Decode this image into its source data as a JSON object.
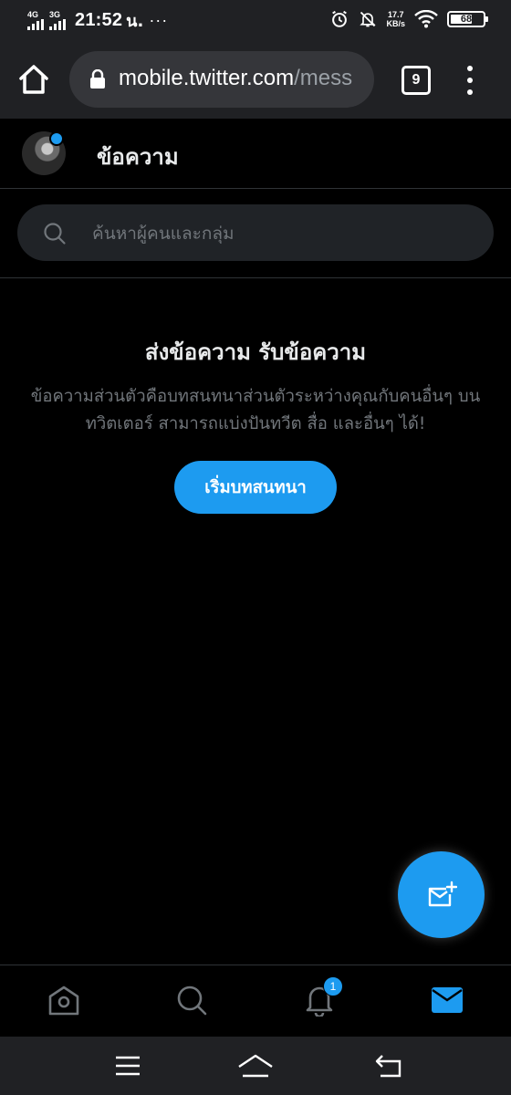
{
  "status_bar": {
    "net1_label": "4G",
    "net2_label": "3G",
    "time": "21:52",
    "time_suffix": "น.",
    "more_indicator": "···",
    "speed_value": "17.7",
    "speed_unit": "KB/s",
    "battery_level": 68,
    "battery_label": "68"
  },
  "browser": {
    "url_host": "mobile.twitter.com",
    "url_path": "/mess",
    "tab_count": "9"
  },
  "header": {
    "title": "ข้อความ"
  },
  "search": {
    "placeholder": "ค้นหาผู้คนและกลุ่ม"
  },
  "empty_state": {
    "title": "ส่งข้อความ รับข้อความ",
    "description": "ข้อความส่วนตัวคือบทสนทนาส่วนตัวระหว่างคุณกับคนอื่นๆ บนทวิตเตอร์ สามารถแบ่งปันทวีต สื่อ และอื่นๆ ได้!",
    "button_label": "เริ่มบทสนทนา"
  },
  "bottom_nav": {
    "notifications_badge": "1",
    "active_item": "messages"
  },
  "colors": {
    "accent": "#1d9bf0",
    "background": "#000000",
    "chrome_toolbar": "#202124",
    "muted_text": "#71767b"
  },
  "icons": {
    "fab": "new-message-icon",
    "nav": [
      "home-icon",
      "search-icon",
      "bell-icon",
      "mail-icon"
    ],
    "system_nav": [
      "menu-icon",
      "home-icon",
      "back-icon"
    ]
  }
}
